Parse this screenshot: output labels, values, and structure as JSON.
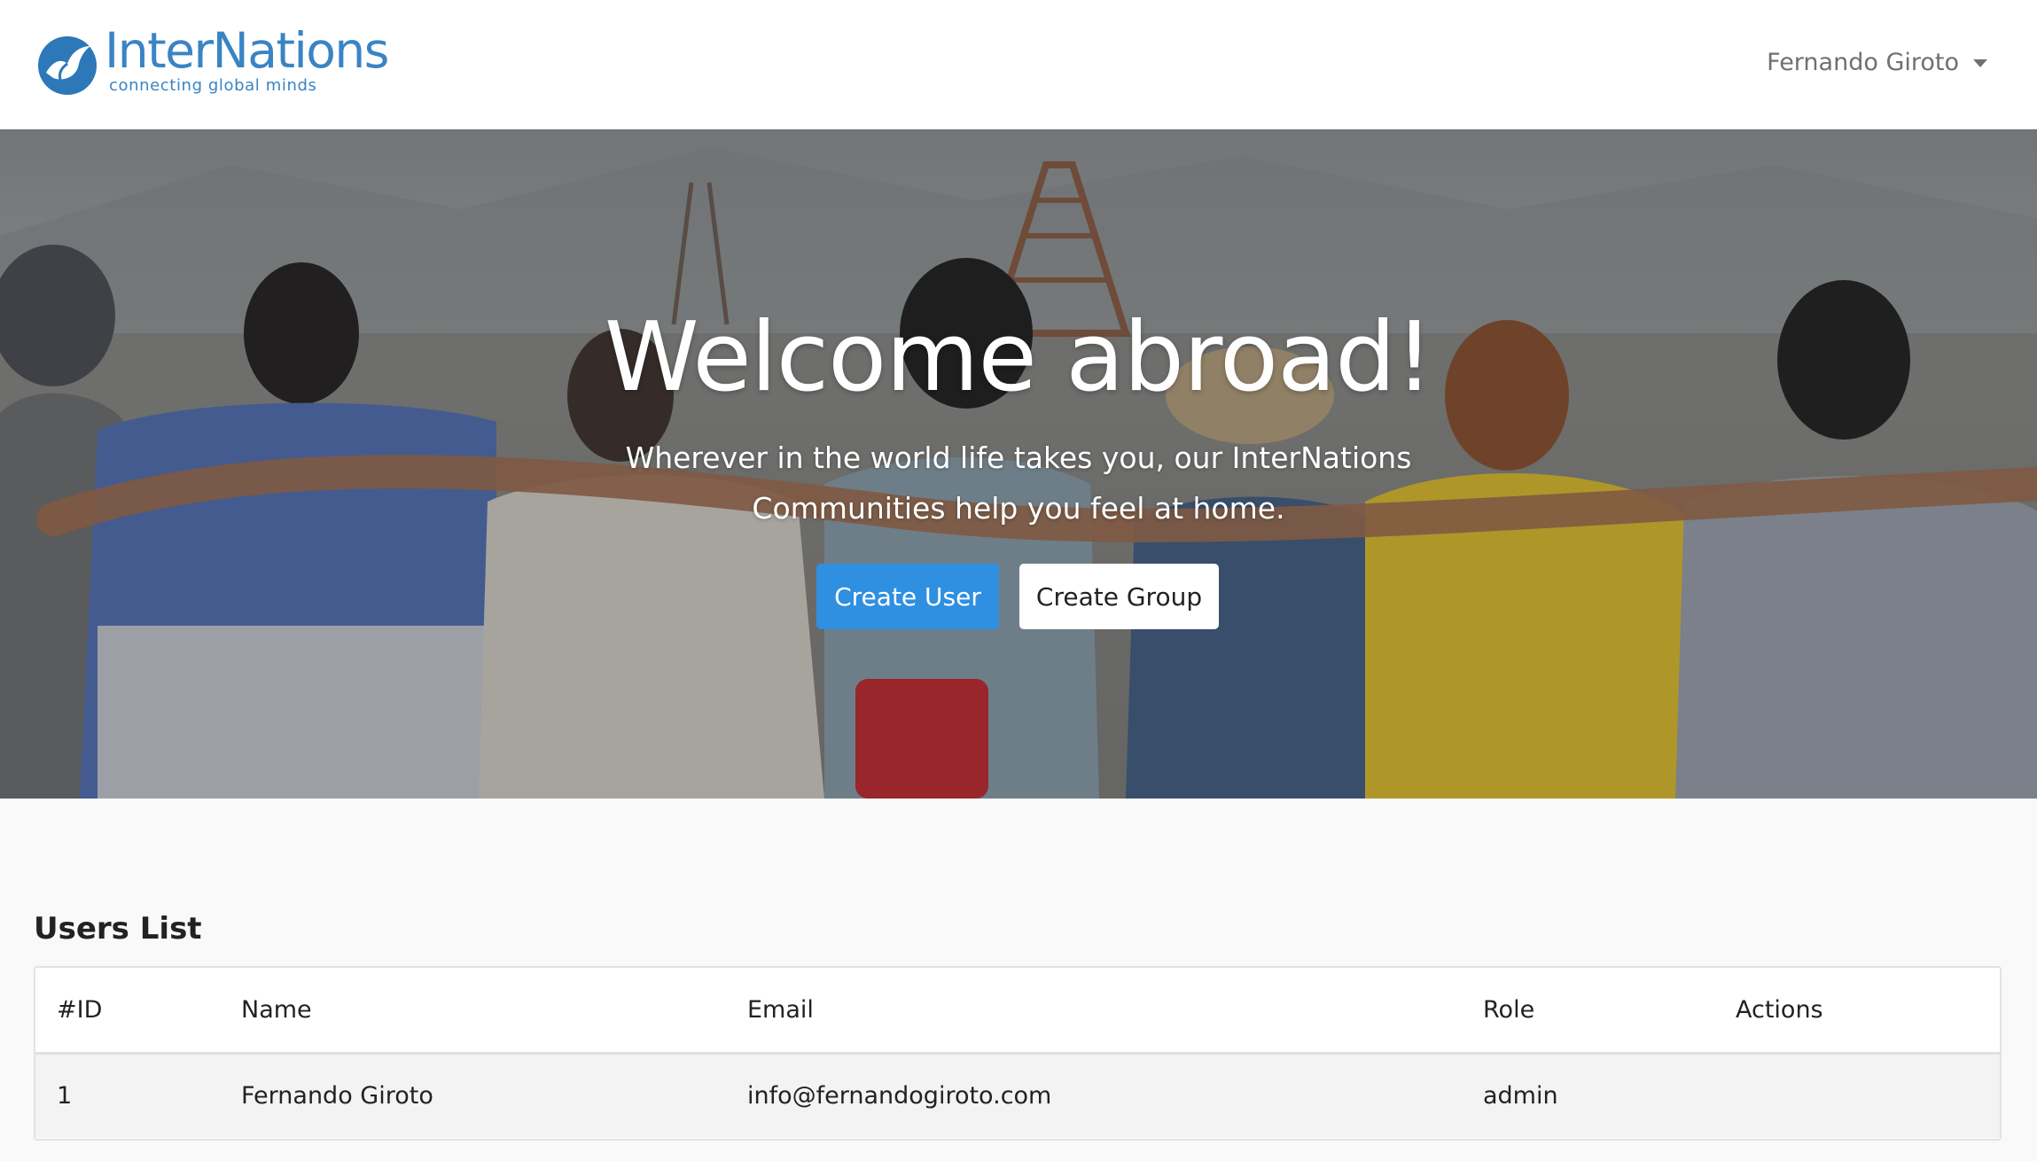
{
  "brand": {
    "name": "InterNations",
    "tagline": "connecting global minds",
    "color": "#3a84c4"
  },
  "nav": {
    "user_name": "Fernando Giroto"
  },
  "hero": {
    "title": "Welcome abroad!",
    "subtitle": "Wherever in the world life takes you, our InterNations Communities help you feel at home.",
    "primary_button": "Create User",
    "secondary_button": "Create Group",
    "primary_color": "#2f8fe0"
  },
  "users": {
    "title": "Users List",
    "columns": [
      "#ID",
      "Name",
      "Email",
      "Role",
      "Actions"
    ],
    "rows": [
      {
        "id": "1",
        "name": "Fernando Giroto",
        "email": "info@fernandogiroto.com",
        "role": "admin",
        "actions": ""
      }
    ]
  },
  "icons": {
    "logo": "bird-globe-logo-icon",
    "menu_caret": "chevron-down-icon"
  }
}
